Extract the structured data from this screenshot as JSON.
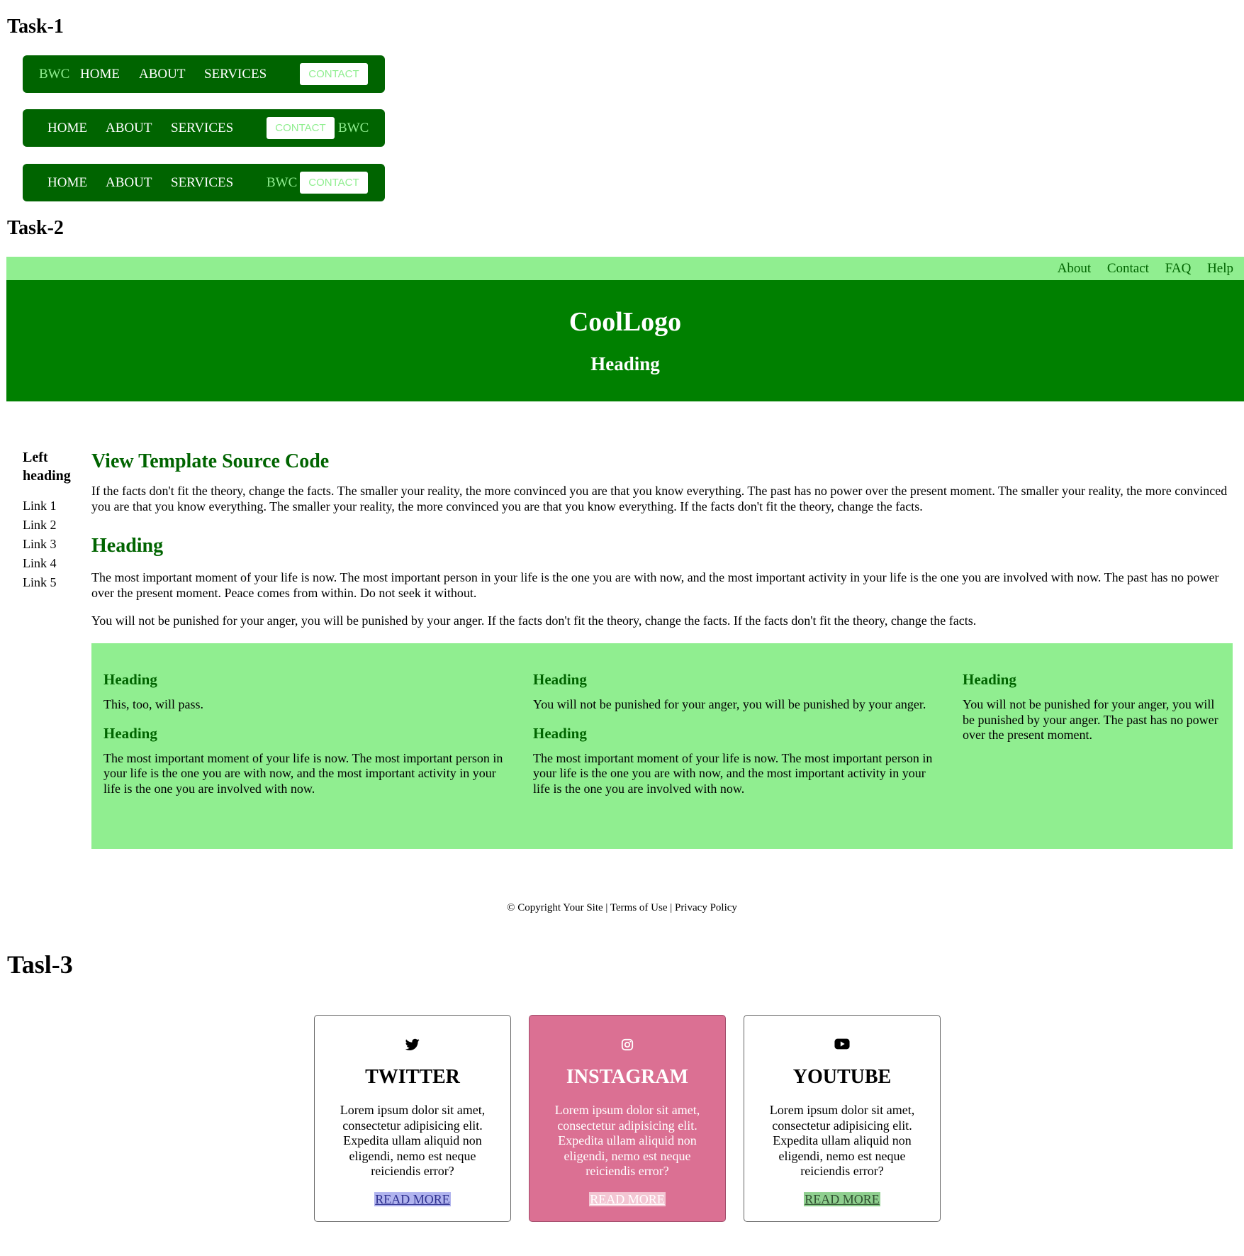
{
  "task1": {
    "title": "Task-1",
    "brand": "BWC",
    "links": [
      "HOME",
      "ABOUT",
      "SERVICES"
    ],
    "contact": "CONTACT"
  },
  "task2": {
    "title": "Task-2",
    "top_links": [
      "About",
      "Contact",
      "FAQ",
      "Help"
    ],
    "logo": "CoolLogo",
    "banner_heading": "Heading",
    "sidebar": {
      "heading": "Left heading",
      "links": [
        "Link 1",
        "Link 2",
        "Link 3",
        "Link 4",
        "Link 5"
      ]
    },
    "main": {
      "title": "View Template Source Code",
      "para1": "If the facts don't fit the theory, change the facts. The smaller your reality, the more convinced you are that you know everything. The past has no power over the present moment. The smaller your reality, the more convinced you are that you know everything. The smaller your reality, the more convinced you are that you know everything. If the facts don't fit the theory, change the facts.",
      "heading2": "Heading",
      "para2": "The most important moment of your life is now. The most important person in your life is the one you are with now, and the most important activity in your life is the one you are involved with now. The past has no power over the present moment. Peace comes from within. Do not seek it without.",
      "para3": "You will not be punished for your anger, you will be punished by your anger. If the facts don't fit the theory, change the facts. If the facts don't fit the theory, change the facts."
    },
    "columns": [
      {
        "h1": "Heading",
        "p1": "This, too, will pass.",
        "h2": "Heading",
        "p2": "The most important moment of your life is now. The most important person in your life is the one you are with now, and the most important activity in your life is the one you are involved with now."
      },
      {
        "h1": "Heading",
        "p1": "You will not be punished for your anger, you will be punished by your anger.",
        "h2": "Heading",
        "p2": "The most important moment of your life is now. The most important person in your life is the one you are with now, and the most important activity in your life is the one you are involved with now."
      },
      {
        "h1": "Heading",
        "p1": "You will not be punished for your anger, you will be punished by your anger. The past has no power over the present moment."
      }
    ],
    "footer": {
      "copyright": "© Copyright Your Site",
      "sep": " | ",
      "terms": "Terms of Use",
      "privacy": "Privacy Policy"
    }
  },
  "task3": {
    "title": "Tasl-3",
    "cards": [
      {
        "icon": "twitter-icon",
        "title": "TWITTER",
        "body": "Lorem ipsum dolor sit amet, consectetur adipisicing elit. Expedita ullam aliquid non eligendi, nemo est neque reiciendis error?",
        "link": "READ MORE"
      },
      {
        "icon": "instagram-icon",
        "title": "INSTAGRAM",
        "body": "Lorem ipsum dolor sit amet, consectetur adipisicing elit. Expedita ullam aliquid non eligendi, nemo est neque reiciendis error?",
        "link": "READ MORE"
      },
      {
        "icon": "youtube-icon",
        "title": "YOUTUBE",
        "body": "Lorem ipsum dolor sit amet, consectetur adipisicing elit. Expedita ullam aliquid non eligendi, nemo est neque reiciendis error?",
        "link": "READ MORE"
      }
    ]
  },
  "colors": {
    "dark_green": "#006400",
    "green": "#008000",
    "light_green": "#90ee90",
    "pink": "#db7093"
  }
}
